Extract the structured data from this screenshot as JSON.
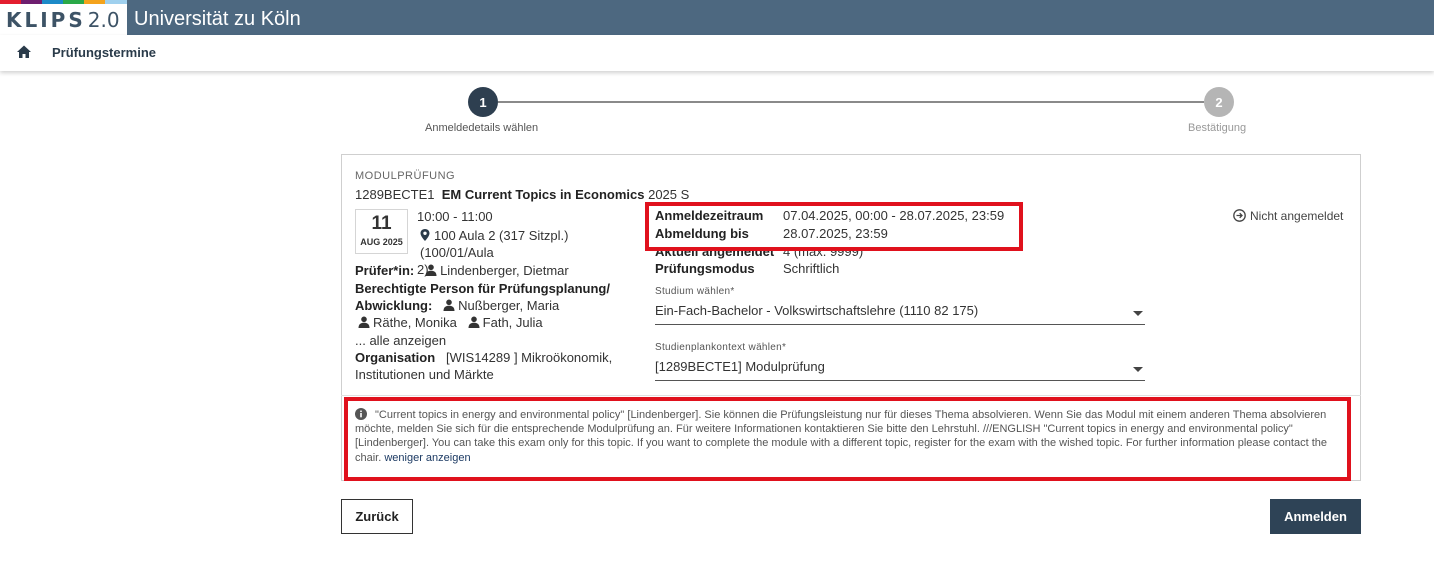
{
  "header": {
    "logo": "KLIPS",
    "logo_version": "2.0",
    "university": "Universität zu Köln",
    "strip_colors": [
      "#e31d2e",
      "#6e1e6f",
      "#1c8ac8",
      "#2aa948",
      "#f4a31c",
      "#ffffff"
    ],
    "brand_color": "#4d6880"
  },
  "subnav": {
    "title": "Prüfungstermine",
    "icon": "home-icon"
  },
  "stepper": {
    "steps": [
      {
        "number": "1",
        "label": "Anmeldedetails wählen"
      },
      {
        "number": "2",
        "label": "Bestätigung"
      }
    ]
  },
  "card": {
    "section_label": "MODULPRÜFUNG",
    "course_code": "1289BECTE1",
    "course_title": "EM Current Topics in Economics",
    "course_term": "2025 S",
    "date_day": "11",
    "date_month": "AUG 2025",
    "time": "10:00 - 11:00",
    "room_line1": "100 Aula 2 (317 Sitzpl.) (100/01/Aula",
    "room_line2": "2)",
    "pruefer_label": "Prüfer*in:",
    "pruefer_name": "Lindenberger, Dietmar",
    "berechtigt_label_1": "Berechtigte Person für Prüfungsplanung/",
    "berechtigt_label_2": "Abwicklung:",
    "person_1": "Nußberger, Maria",
    "person_2": "Räthe, Monika",
    "person_3": "Fath, Julia",
    "alle_anzeigen": "... alle anzeigen",
    "org_label": "Organisation",
    "org_value_1": "[WIS14289 ] Mikroökonomik,",
    "org_value_2": "Institutionen und Märkte",
    "anmeldezeitraum_label": "Anmeldezeitraum",
    "anmeldezeitraum_value": "07.04.2025, 00:00 - 28.07.2025, 23:59",
    "abmeldung_label": "Abmeldung bis",
    "abmeldung_value": "28.07.2025, 23:59",
    "aktuell_label": "Aktuell angemeldet",
    "aktuell_value": "4 (max. 9999)",
    "modus_label": "Prüfungsmodus",
    "modus_value": "Schriftlich",
    "status": "Nicht angemeldet",
    "studium_label": "Studium wählen*",
    "studium_value": "Ein-Fach-Bachelor - Volkswirtschaftslehre (1110 82 175)",
    "kontext_label": "Studienplankontext wählen*",
    "kontext_value": "[1289BECTE1]  Modulprüfung",
    "notice_text": "\"Current topics in energy and environmental policy\" [Lindenberger].  Sie können die Prüfungsleistung nur für dieses Thema absolvieren. Wenn Sie das Modul mit einem anderen Thema absolvieren möchte, melden Sie sich für die entsprechende Modulprüfung an. Für weitere Informationen kontaktieren Sie bitte den Lehrstuhl.   ///ENGLISH  \"Current topics in energy and environmental policy\" [Lindenberger].  You can take this exam only for this topic. If you want to complete the module with a different topic, register for the exam with the wished topic. For further information please contact the chair.",
    "notice_link": "weniger anzeigen"
  },
  "buttons": {
    "back": "Zurück",
    "submit": "Anmelden"
  },
  "highlight_color": "#e0111d"
}
